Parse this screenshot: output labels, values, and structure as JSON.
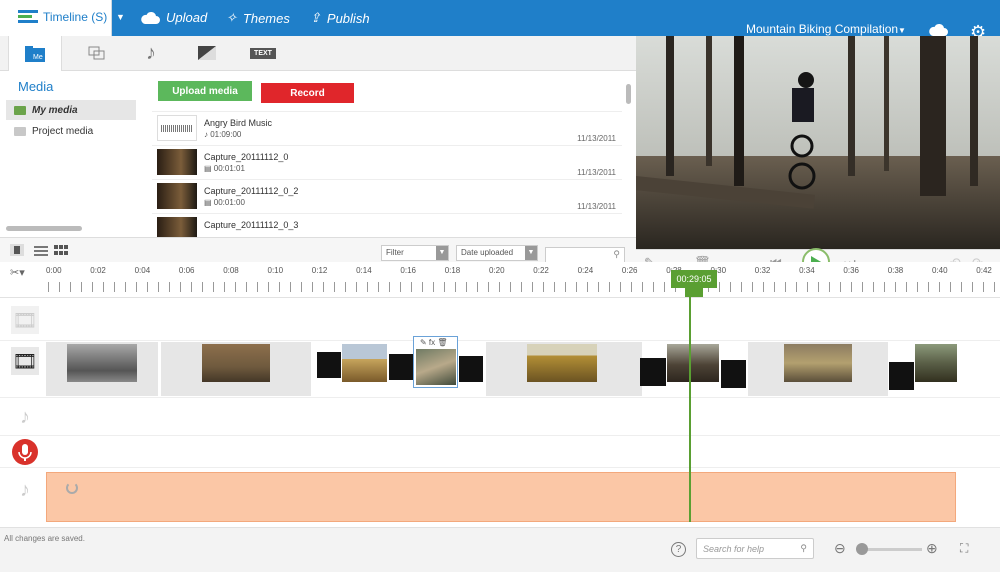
{
  "topbar": {
    "timeline_label": "Timeline (S)",
    "nav": [
      {
        "label": "Upload",
        "icon": "cloud-upload-icon"
      },
      {
        "label": "Themes",
        "icon": "magic-wand-icon"
      },
      {
        "label": "Publish",
        "icon": "upload-arrow-icon"
      }
    ],
    "project_title": "Mountain Biking Compilation"
  },
  "media_panel": {
    "tabs": [
      {
        "name": "media",
        "icon": "film-folder-icon",
        "label": "Me"
      },
      {
        "name": "transitions",
        "icon": "transitions-icon"
      },
      {
        "name": "music",
        "icon": "music-note-icon"
      },
      {
        "name": "effects",
        "icon": "fade-icon"
      },
      {
        "name": "text",
        "icon": "text-icon",
        "label": "TEXT"
      }
    ],
    "heading": "Media",
    "folders": [
      "My media",
      "Project media"
    ],
    "upload_label": "Upload media",
    "record_label": "Record",
    "items": [
      {
        "name": "Angry Bird Music",
        "duration": "01:09:00",
        "date": "11/13/2011",
        "type": "audio"
      },
      {
        "name": "Capture_20111112_0",
        "duration": "00:01:01",
        "date": "11/13/2011",
        "type": "video"
      },
      {
        "name": "Capture_20111112_0_2",
        "duration": "00:01:00",
        "date": "11/13/2011",
        "type": "video"
      },
      {
        "name": "Capture_20111112_0_3",
        "duration": "",
        "date": "",
        "type": "video"
      }
    ],
    "filter_label": "Filter",
    "sort_label": "Date uploaded"
  },
  "timeline": {
    "ticks": [
      "0:00",
      "0:02",
      "0:04",
      "0:06",
      "0:08",
      "0:10",
      "0:12",
      "0:14",
      "0:16",
      "0:18",
      "0:20",
      "0:22",
      "0:24",
      "0:26",
      "0:28",
      "0:30",
      "0:32",
      "0:34",
      "0:36",
      "0:38",
      "0:40",
      "0:42"
    ],
    "playhead": "00:29:05"
  },
  "status": {
    "saved_text": "All changes are saved.",
    "help_placeholder": "Search for help"
  },
  "colors": {
    "brand": "#1f7fc9",
    "accent": "#5a9f32",
    "record": "#e0262b",
    "audio_clip": "#fbc7a6"
  }
}
